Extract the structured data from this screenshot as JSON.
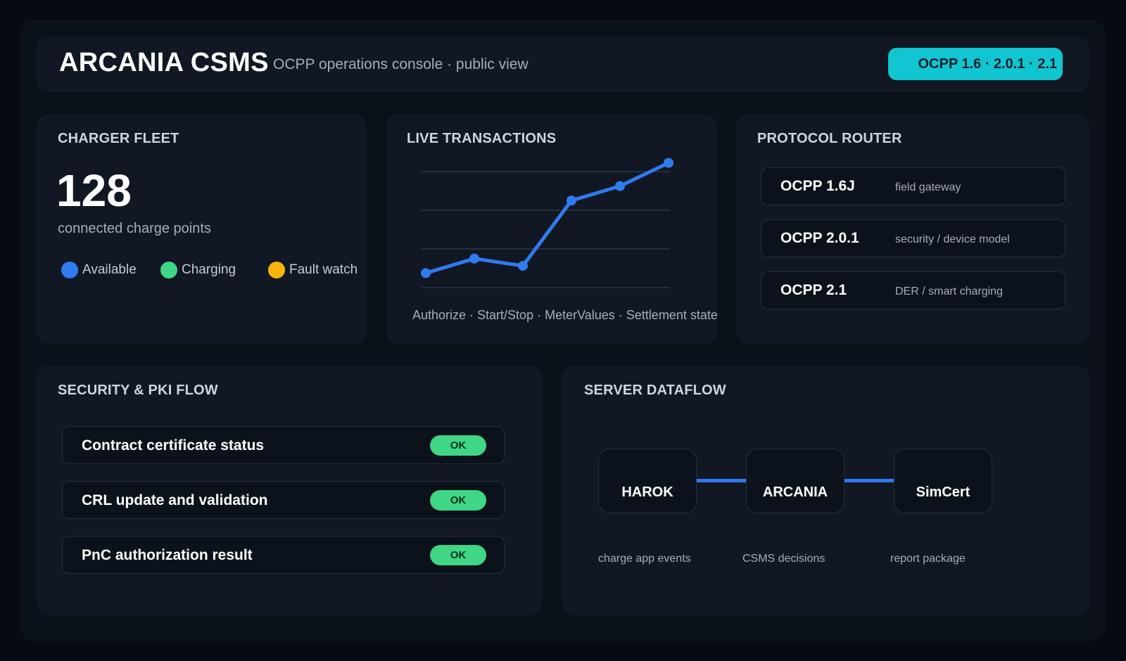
{
  "header": {
    "brand": "ARCANIA CSMS",
    "subtitle": "OCPP operations console · public view",
    "protocol_pill": "OCPP 1.6 · 2.0.1 · 2.1"
  },
  "fleet": {
    "title": "CHARGER FLEET",
    "count": "128",
    "caption": "connected charge points",
    "legend": [
      {
        "label": "Available",
        "color": "#2f7bf0"
      },
      {
        "label": "Charging",
        "color": "#3fd685"
      },
      {
        "label": "Fault watch",
        "color": "#f5b50b"
      }
    ]
  },
  "live": {
    "title": "LIVE TRANSACTIONS",
    "caption": "Authorize · Start/Stop · MeterValues · Settlement state",
    "line_color": "#2f7bf0"
  },
  "chart_data": {
    "type": "line",
    "x": [
      1,
      2,
      3,
      4,
      5,
      6
    ],
    "series": [
      {
        "values": [
          0.5,
          1.0,
          0.75,
          3.0,
          3.5,
          4.3
        ]
      }
    ],
    "ylim": [
      0,
      4
    ],
    "grid": true,
    "xlabel": "",
    "ylabel": ""
  },
  "router": {
    "title": "PROTOCOL ROUTER",
    "rows": [
      {
        "name": "OCPP 1.6J",
        "desc": "field gateway"
      },
      {
        "name": "OCPP 2.0.1",
        "desc": "security / device model"
      },
      {
        "name": "OCPP 2.1",
        "desc": "DER / smart charging"
      }
    ]
  },
  "security": {
    "title": "SECURITY & PKI FLOW",
    "rows": [
      {
        "label": "Contract certificate status",
        "status": "OK"
      },
      {
        "label": "CRL update and validation",
        "status": "OK"
      },
      {
        "label": "PnC authorization result",
        "status": "OK"
      }
    ]
  },
  "dataflow": {
    "title": "SERVER DATAFLOW",
    "nodes": [
      {
        "name": "HAROK",
        "caption": "charge app events"
      },
      {
        "name": "ARCANIA",
        "caption": "CSMS decisions"
      },
      {
        "name": "SimCert",
        "caption": "report package"
      }
    ]
  }
}
